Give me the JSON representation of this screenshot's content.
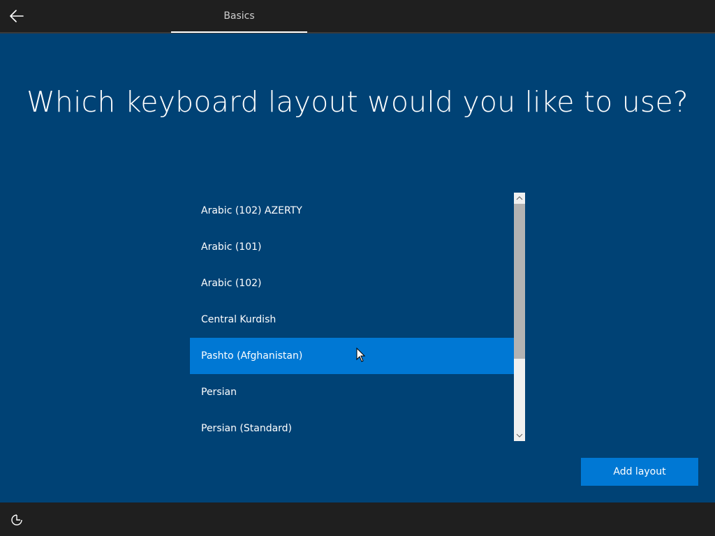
{
  "header": {
    "back_icon": "arrow-left-icon",
    "tab_label": "Basics"
  },
  "main": {
    "title": "Which keyboard layout would you like to use?",
    "items": [
      {
        "label": "Arabic (102) AZERTY",
        "selected": false
      },
      {
        "label": "Arabic (101)",
        "selected": false
      },
      {
        "label": "Arabic (102)",
        "selected": false
      },
      {
        "label": "Central Kurdish",
        "selected": false
      },
      {
        "label": "Pashto (Afghanistan)",
        "selected": true
      },
      {
        "label": "Persian",
        "selected": false
      },
      {
        "label": "Persian (Standard)",
        "selected": false
      }
    ],
    "add_layout_label": "Add layout"
  },
  "footer": {
    "ease_of_access_icon": "ease-of-access-icon"
  },
  "colors": {
    "background": "#004275",
    "accent": "#0078d4",
    "bar": "#1f1f1f"
  }
}
